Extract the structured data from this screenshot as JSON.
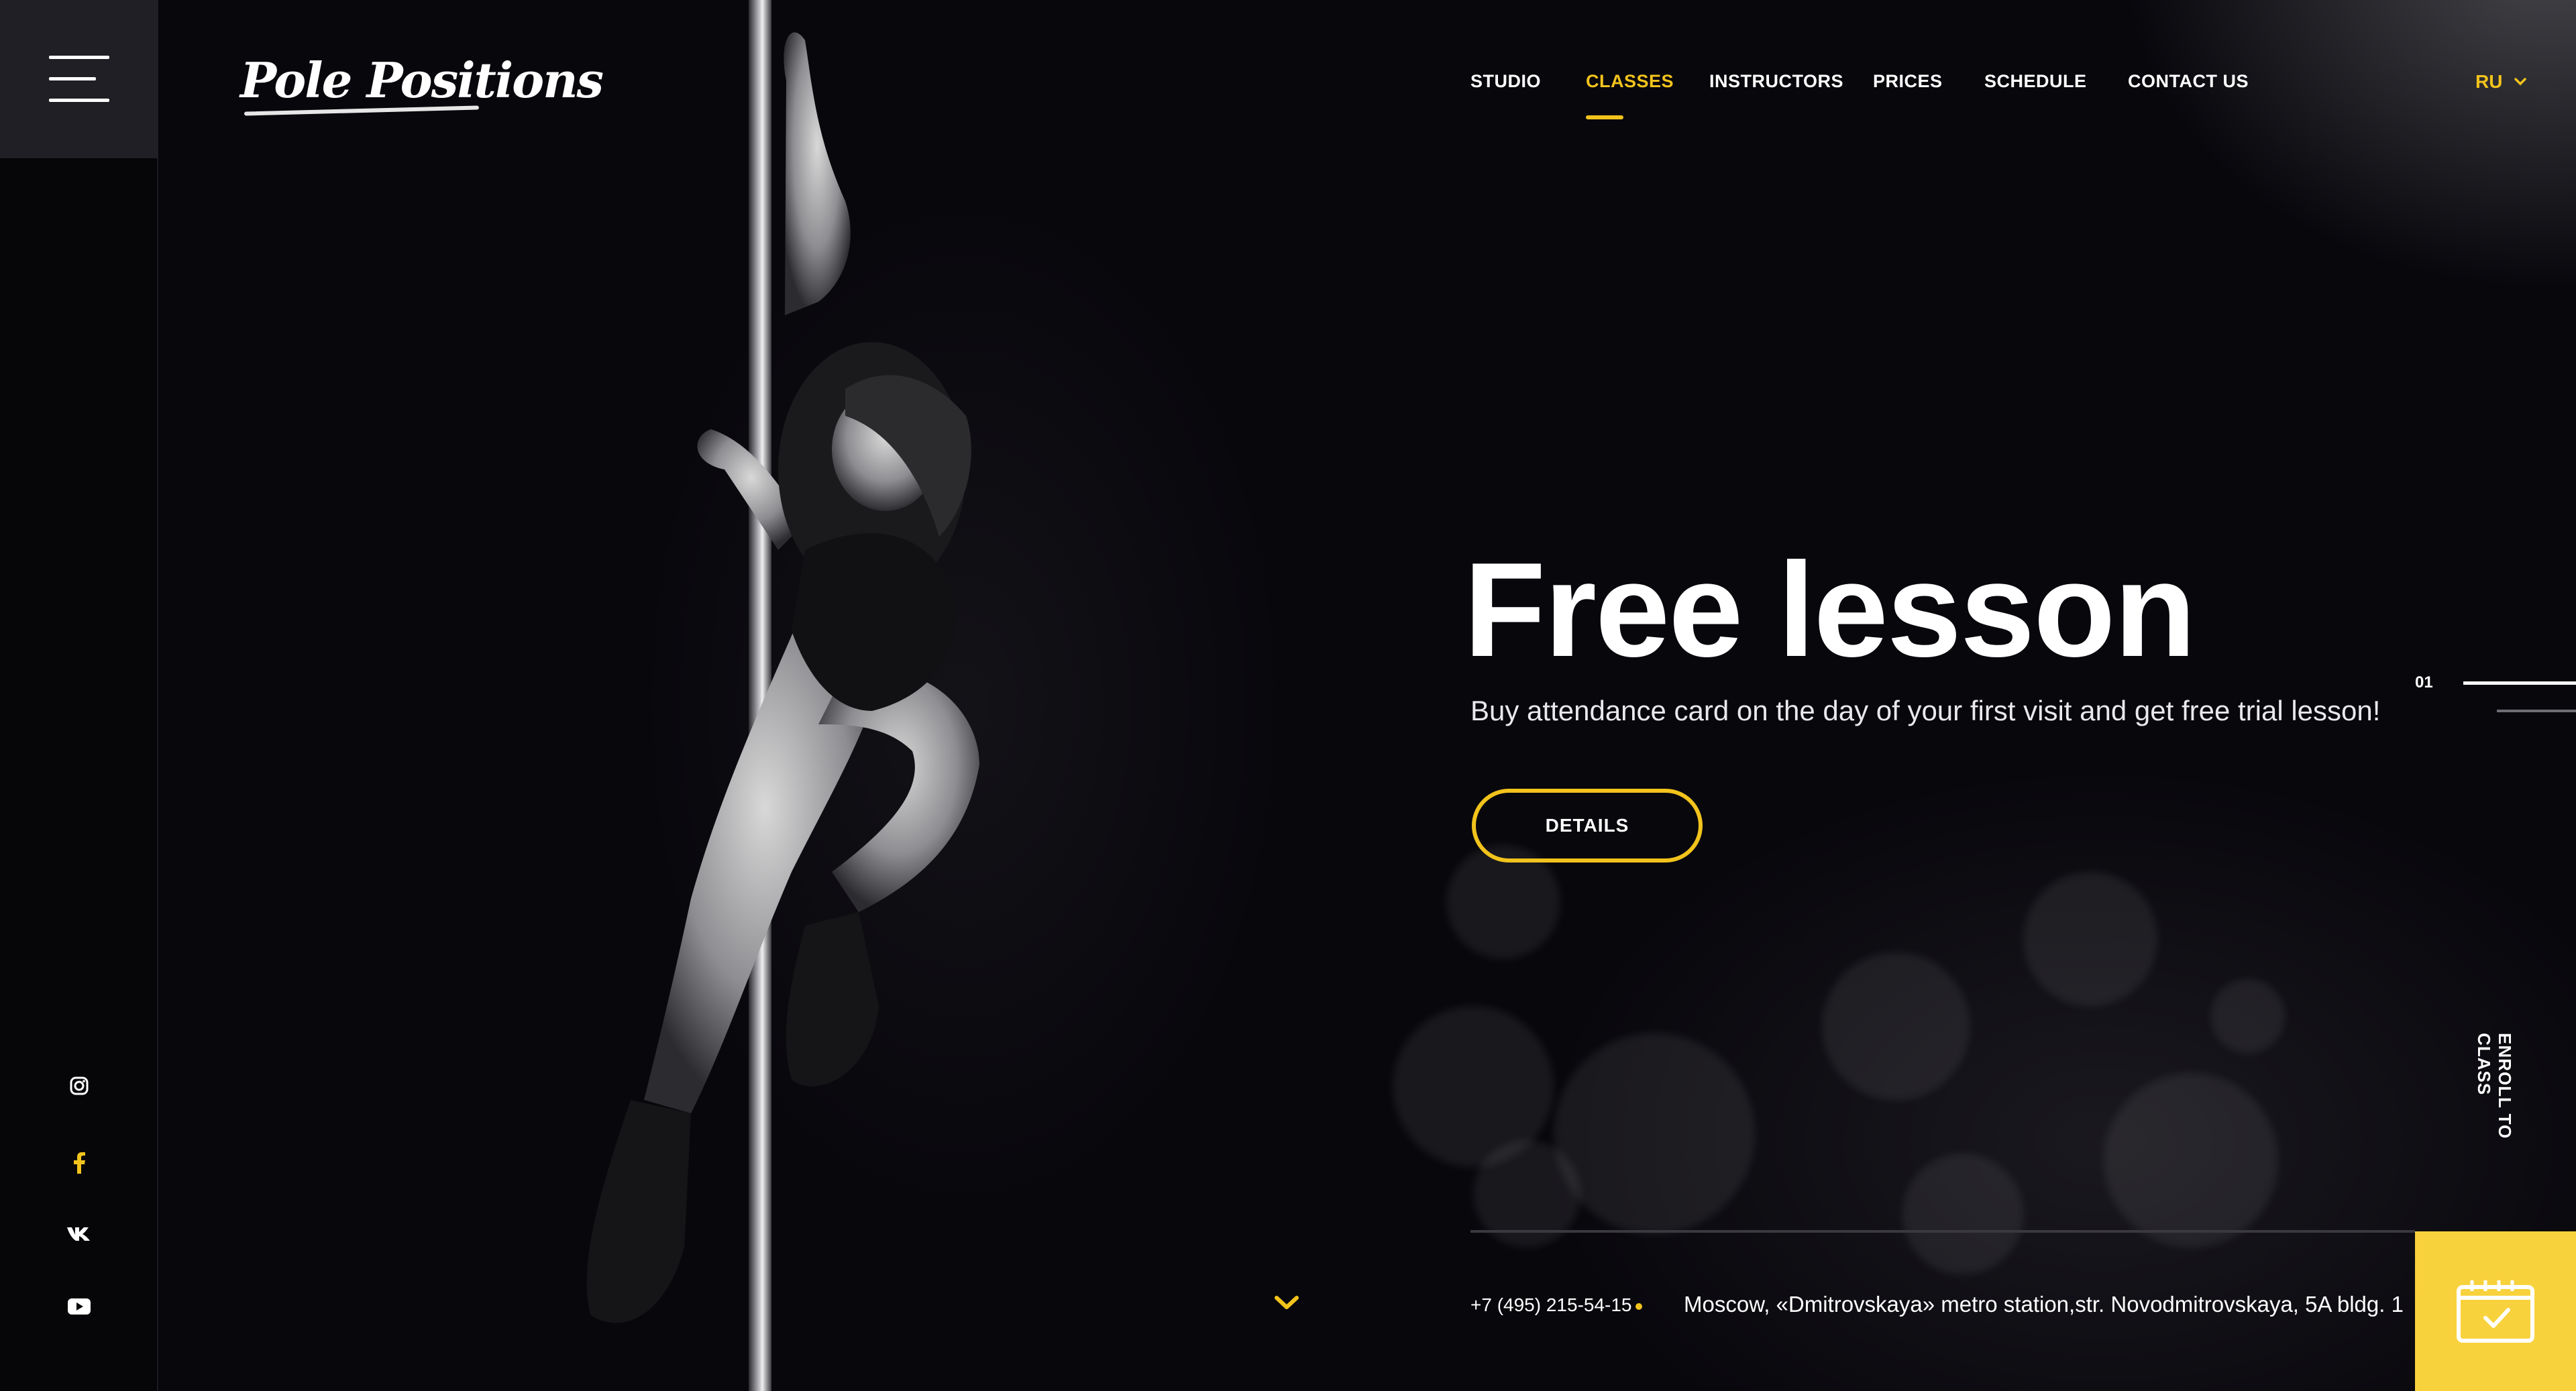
{
  "brand": {
    "logo_text": "Pole Positions"
  },
  "nav": {
    "items": [
      {
        "label": "STUDIO"
      },
      {
        "label": "CLASSES"
      },
      {
        "label": "INSTRUCTORS"
      },
      {
        "label": "PRICES"
      },
      {
        "label": "SCHEDULE"
      },
      {
        "label": "CONTACT US"
      }
    ],
    "active": "CLASSES"
  },
  "language": {
    "current": "RU"
  },
  "hero": {
    "title": "Free lesson",
    "subtitle": "Buy attendance card on the day of your first visit and get free trial lesson!",
    "button_label": "DETAILS"
  },
  "slider": {
    "current": "01"
  },
  "enroll": {
    "label": "ENROLL TO CLASS"
  },
  "contacts": {
    "phone": "+7 (495) 215-54-15",
    "address": "Moscow, «Dmitrovskaya» metro station,str. Novodmitrovskaya, 5A bldg. 1"
  },
  "social": [
    "instagram-icon",
    "facebook-icon",
    "vk-icon",
    "youtube-icon"
  ],
  "colors": {
    "accent": "#f2c31c",
    "background": "#07060a",
    "menu_box": "#1f1f25"
  }
}
